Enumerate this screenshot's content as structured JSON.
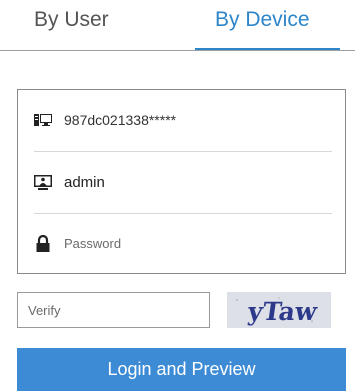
{
  "tabs": {
    "by_user": "By User",
    "by_device": "By Device",
    "active": "By Device"
  },
  "form": {
    "device_id": "987dc021338*****",
    "username": "admin",
    "password_placeholder": "Password",
    "verify_placeholder": "Verify",
    "captcha_text": "yTaw",
    "submit_label": "Login and Preview"
  },
  "icons": {
    "device": "device-icon",
    "user": "user-monitor-icon",
    "password": "lock-icon"
  },
  "colors": {
    "accent": "#2e86c9",
    "button": "#3d8bd4",
    "captcha_text": "#2d3a8c",
    "tab_inactive": "#555555"
  }
}
